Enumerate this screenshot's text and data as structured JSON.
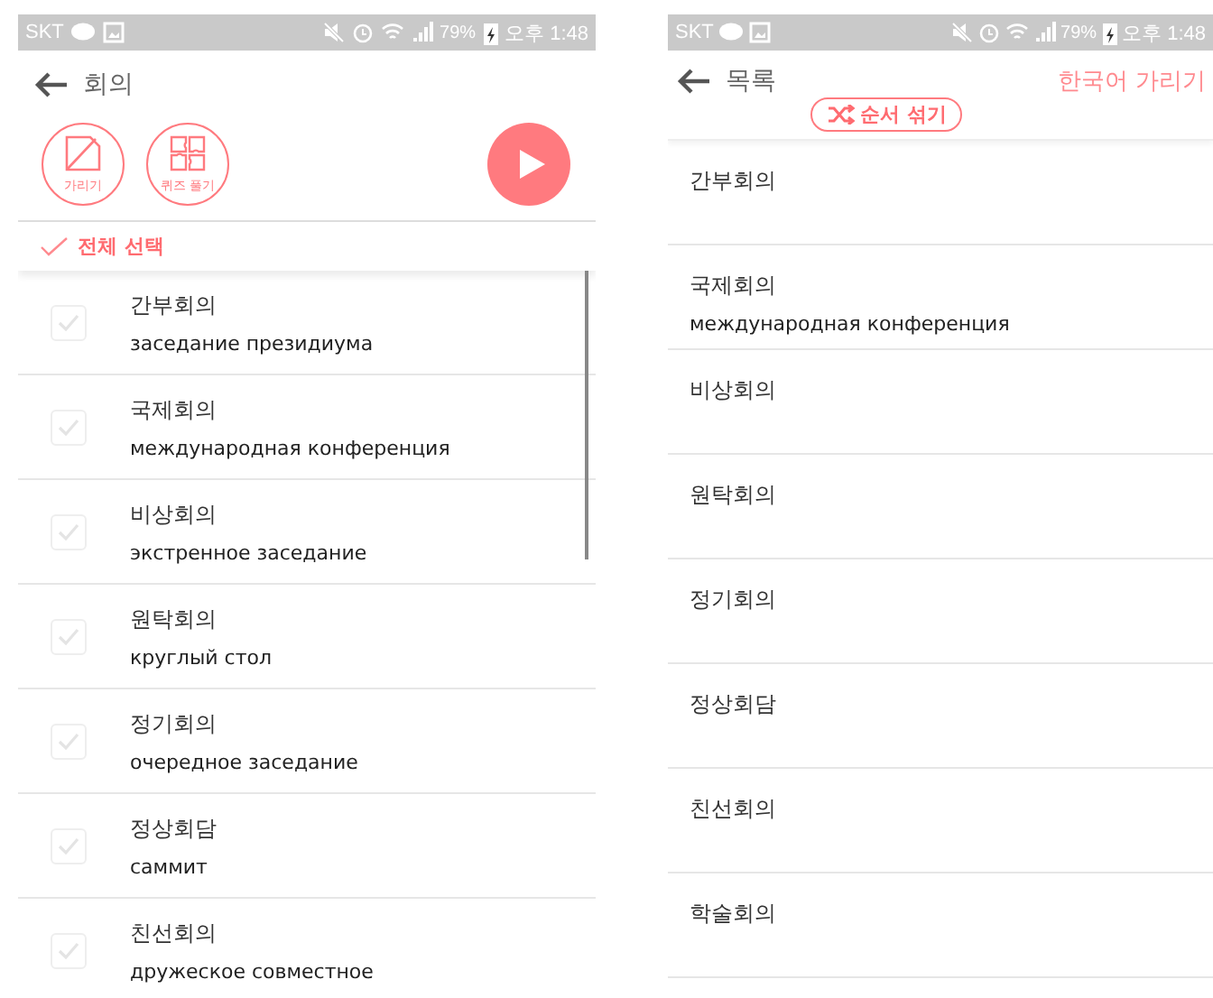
{
  "select_screen": {
    "status_bar": {
      "carrier": "SKT",
      "battery": "79%",
      "time": "오후 1:48"
    },
    "title": "회의",
    "tools": [
      {
        "label": "가리기",
        "kind": "hide"
      },
      {
        "label": "퀴즈 풀기",
        "kind": "quiz"
      }
    ],
    "select_all": "전체 선택",
    "rows": [
      {
        "word": "간부회의",
        "meaning": "заседание президиума",
        "checked": false
      },
      {
        "word": "국제회의",
        "meaning": "международная конференция",
        "checked": false
      },
      {
        "word": "비상회의",
        "meaning": "экстренное заседание",
        "checked": false
      },
      {
        "word": "원탁회의",
        "meaning": "круглый стол",
        "checked": false
      },
      {
        "word": "정기회의",
        "meaning": "очередное заседание",
        "checked": false
      },
      {
        "word": "정상회담",
        "meaning": "саммит",
        "checked": false
      },
      {
        "word": "친선회의",
        "meaning": "дружеское совместное",
        "checked": false
      }
    ]
  },
  "list_screen": {
    "status_bar": {
      "carrier": "SKT",
      "battery": "79%",
      "time": "오후 1:48"
    },
    "title": "목록",
    "hide_button": "한국어 가리기",
    "shuffle_button": "순서 섞기",
    "rows": [
      {
        "word": "간부회의"
      },
      {
        "word": "국제회의",
        "meaning": "международная конференция"
      },
      {
        "word": "비상회의"
      },
      {
        "word": "원탁회의"
      },
      {
        "word": "정기회의"
      },
      {
        "word": "정상회담"
      },
      {
        "word": "친선회의"
      },
      {
        "word": "학술회의"
      }
    ]
  }
}
